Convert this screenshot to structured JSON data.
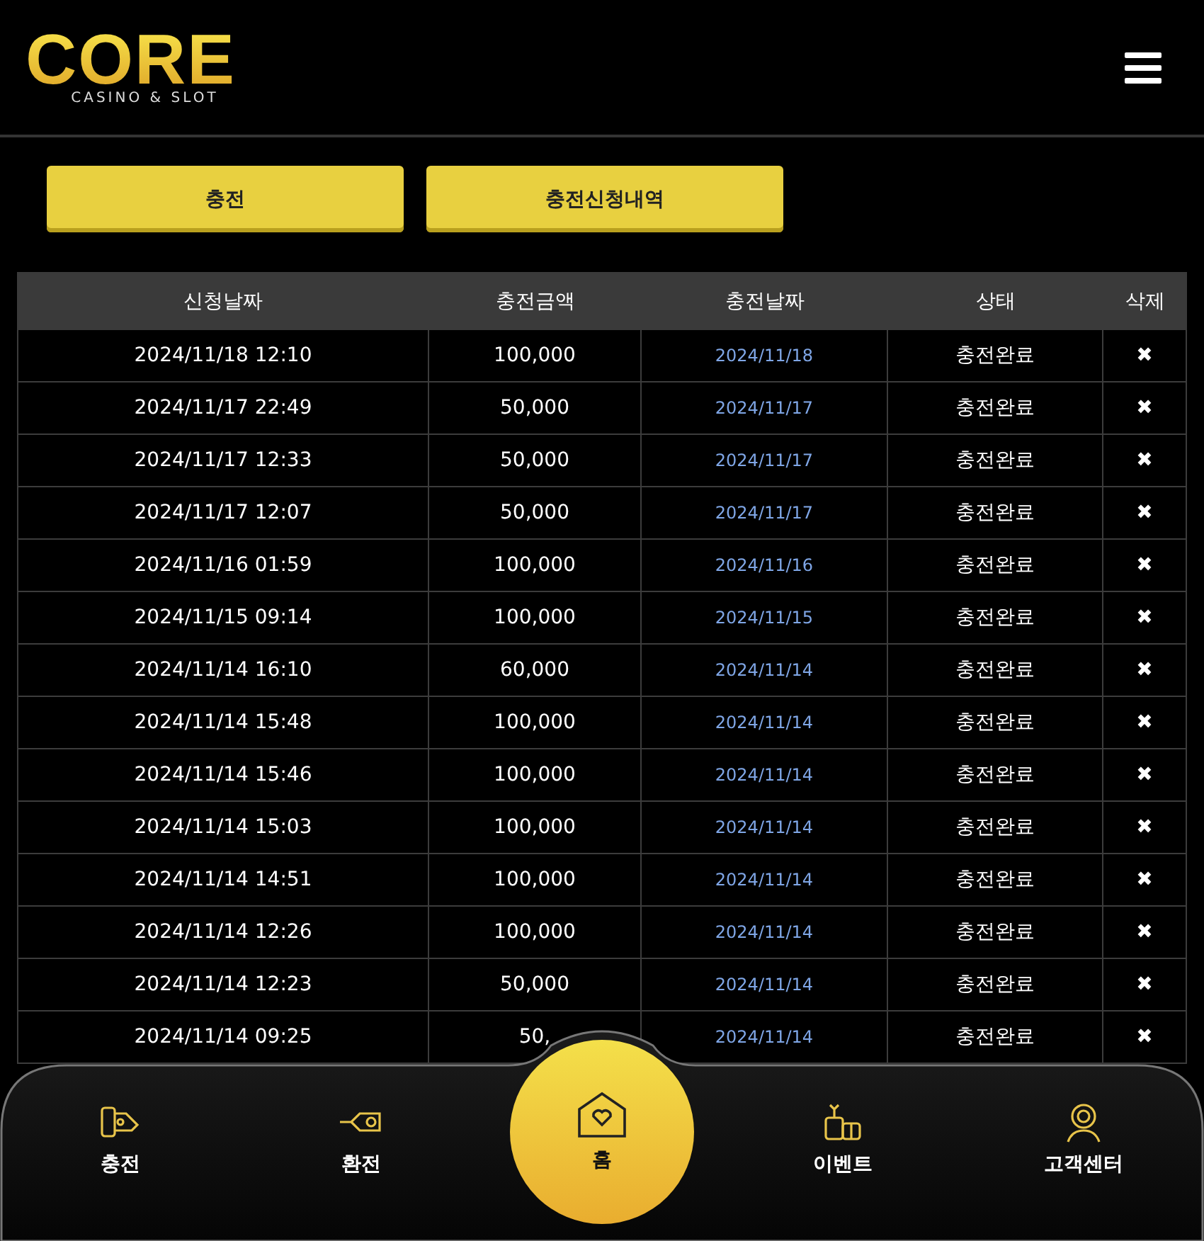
{
  "logo": {
    "title": "CORE",
    "subtitle": "CASINO & SLOT"
  },
  "buttons": [
    "충전",
    "충전신청내역"
  ],
  "table": {
    "columns": [
      "신청날짜",
      "충전금액",
      "충전날짜",
      "상태",
      "삭제"
    ],
    "rows": [
      {
        "requested": "2024/11/18 12:10",
        "amount": "100,000",
        "charged": "2024/11/18",
        "status": "충전완료",
        "delete": "✖"
      },
      {
        "requested": "2024/11/17 22:49",
        "amount": "50,000",
        "charged": "2024/11/17",
        "status": "충전완료",
        "delete": "✖"
      },
      {
        "requested": "2024/11/17 12:33",
        "amount": "50,000",
        "charged": "2024/11/17",
        "status": "충전완료",
        "delete": "✖"
      },
      {
        "requested": "2024/11/17 12:07",
        "amount": "50,000",
        "charged": "2024/11/17",
        "status": "충전완료",
        "delete": "✖"
      },
      {
        "requested": "2024/11/16 01:59",
        "amount": "100,000",
        "charged": "2024/11/16",
        "status": "충전완료",
        "delete": "✖"
      },
      {
        "requested": "2024/11/15 09:14",
        "amount": "100,000",
        "charged": "2024/11/15",
        "status": "충전완료",
        "delete": "✖"
      },
      {
        "requested": "2024/11/14 16:10",
        "amount": "60,000",
        "charged": "2024/11/14",
        "status": "충전완료",
        "delete": "✖"
      },
      {
        "requested": "2024/11/14 15:48",
        "amount": "100,000",
        "charged": "2024/11/14",
        "status": "충전완료",
        "delete": "✖"
      },
      {
        "requested": "2024/11/14 15:46",
        "amount": "100,000",
        "charged": "2024/11/14",
        "status": "충전완료",
        "delete": "✖"
      },
      {
        "requested": "2024/11/14 15:03",
        "amount": "100,000",
        "charged": "2024/11/14",
        "status": "충전완료",
        "delete": "✖"
      },
      {
        "requested": "2024/11/14 14:51",
        "amount": "100,000",
        "charged": "2024/11/14",
        "status": "충전완료",
        "delete": "✖"
      },
      {
        "requested": "2024/11/14 12:26",
        "amount": "100,000",
        "charged": "2024/11/14",
        "status": "충전완료",
        "delete": "✖"
      },
      {
        "requested": "2024/11/14 12:23",
        "amount": "50,000",
        "charged": "2024/11/14",
        "status": "충전완료",
        "delete": "✖"
      },
      {
        "requested": "2024/11/14 09:25",
        "amount": "50,",
        "charged": "2024/11/14",
        "status": "충전완료",
        "delete": "✖"
      }
    ]
  },
  "bottom_nav": [
    {
      "label": "충전",
      "kind": "deposit"
    },
    {
      "label": "환전",
      "kind": "withdraw"
    },
    {
      "label": "홈",
      "kind": "home"
    },
    {
      "label": "이벤트",
      "kind": "event"
    },
    {
      "label": "고객센터",
      "kind": "support"
    }
  ]
}
